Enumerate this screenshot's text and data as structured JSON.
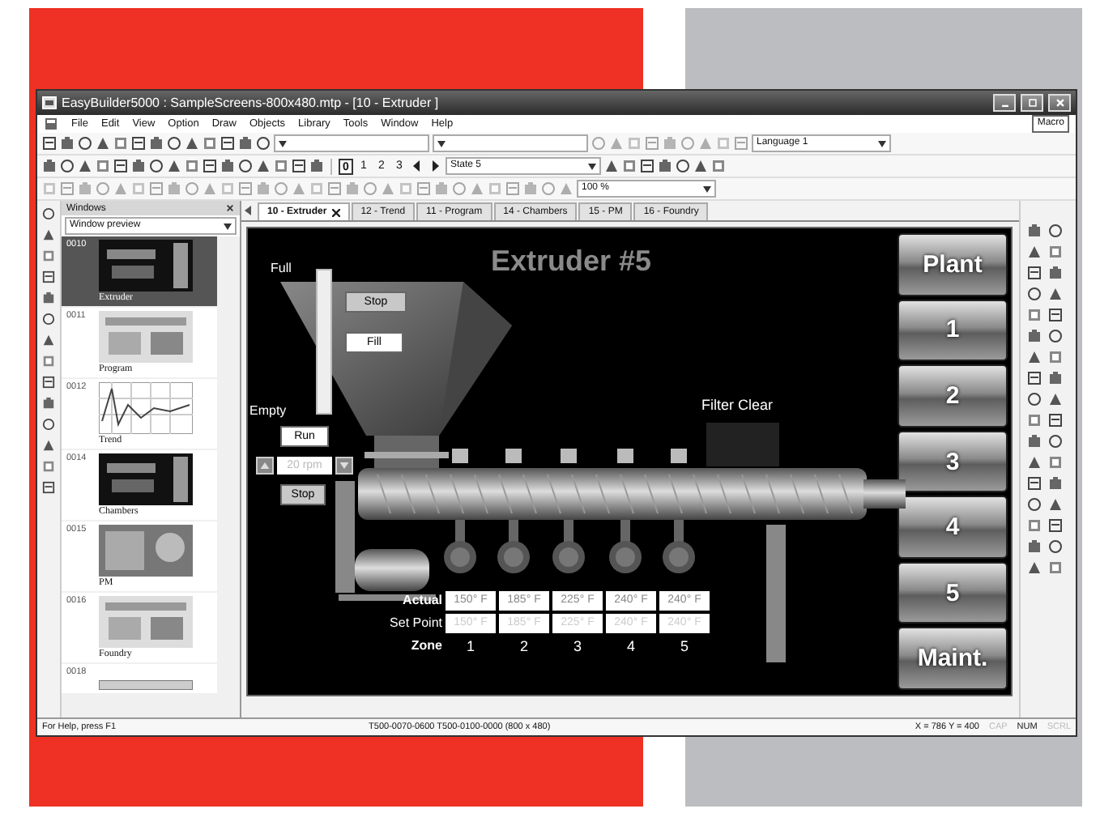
{
  "window": {
    "title": "EasyBuilder5000 : SampleScreens-800x480.mtp - [10 - Extruder ]",
    "macro": "Macro"
  },
  "menu": [
    "File",
    "Edit",
    "View",
    "Option",
    "Draw",
    "Objects",
    "Library",
    "Tools",
    "Window",
    "Help"
  ],
  "toolbar": {
    "language": "Language 1",
    "pages": [
      {
        "label": "0",
        "selected": true
      },
      {
        "label": "1",
        "selected": false
      },
      {
        "label": "2",
        "selected": false
      },
      {
        "label": "3",
        "selected": false
      }
    ],
    "state": "State 5",
    "zoom": "100 %"
  },
  "windows_panel": {
    "title": "Windows",
    "view": "Window preview",
    "items": [
      {
        "number": "0010",
        "caption": "Extruder",
        "selected": true,
        "kind": "dark"
      },
      {
        "number": "0011",
        "caption": "Program",
        "selected": false,
        "kind": "light"
      },
      {
        "number": "0012",
        "caption": "Trend",
        "selected": false,
        "kind": "chart"
      },
      {
        "number": "0014",
        "caption": "Chambers",
        "selected": false,
        "kind": "dark"
      },
      {
        "number": "0015",
        "caption": "PM",
        "selected": false,
        "kind": "photo"
      },
      {
        "number": "0016",
        "caption": "Foundry",
        "selected": false,
        "kind": "light"
      },
      {
        "number": "0018",
        "selected": false,
        "kind": "partial"
      }
    ]
  },
  "tabs": [
    {
      "label": "10 - Extruder",
      "selected": true
    },
    {
      "label": "12 - Trend",
      "selected": false
    },
    {
      "label": "11 - Program",
      "selected": false
    },
    {
      "label": "14 - Chambers",
      "selected": false
    },
    {
      "label": "15 - PM",
      "selected": false
    },
    {
      "label": "16 - Foundry",
      "selected": false
    }
  ],
  "screen": {
    "title": "Extruder #5",
    "hopper": {
      "full_label": "Full",
      "empty_label": "Empty",
      "level": 1,
      "stop": "Stop",
      "fill": "Fill"
    },
    "feed": {
      "run": "Run",
      "speed": "20 rpm",
      "stop": "Stop"
    },
    "filter_label": "Filter Clear",
    "zones": {
      "actual_label": "Actual",
      "setpoint_label": "Set Point",
      "zone_label": "Zone",
      "items": [
        {
          "zone": "1",
          "actual": "150° F",
          "setpoint": "150° F"
        },
        {
          "zone": "2",
          "actual": "185° F",
          "setpoint": "185° F"
        },
        {
          "zone": "3",
          "actual": "225° F",
          "setpoint": "225° F"
        },
        {
          "zone": "4",
          "actual": "240° F",
          "setpoint": "240° F"
        },
        {
          "zone": "5",
          "actual": "240° F",
          "setpoint": "240° F"
        }
      ]
    },
    "nav": [
      "Plant",
      "1",
      "2",
      "3",
      "4",
      "5",
      "Maint."
    ]
  },
  "status_bar": {
    "help": "For Help, press F1",
    "model": "T500-0070-0600 T500-0100-0000 (800 x 480)",
    "coords": "X = 786 Y = 400",
    "indicators": [
      {
        "label": "CAP",
        "on": false
      },
      {
        "label": "NUM",
        "on": true
      },
      {
        "label": "SCRL",
        "on": false
      }
    ]
  }
}
